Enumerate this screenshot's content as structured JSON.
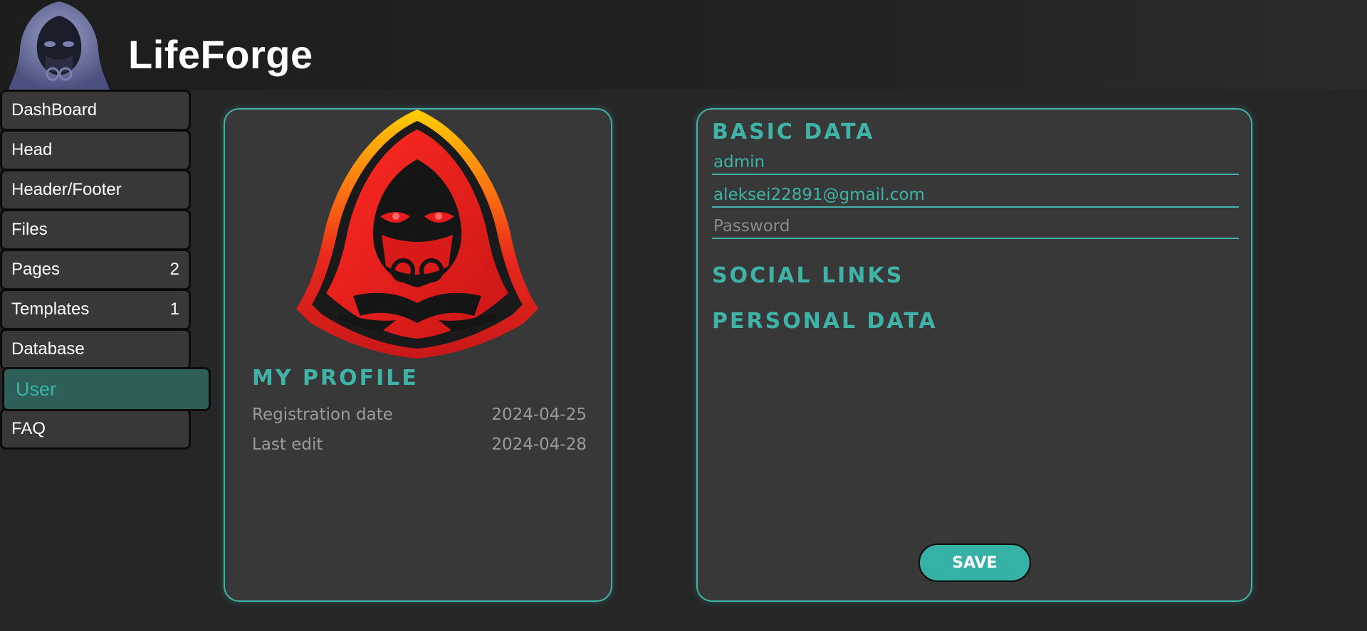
{
  "app": {
    "title": "LifeForge"
  },
  "sidebar": {
    "items": [
      {
        "label": "DashBoard",
        "count": ""
      },
      {
        "label": "Head",
        "count": ""
      },
      {
        "label": "Header/Footer",
        "count": ""
      },
      {
        "label": "Files",
        "count": ""
      },
      {
        "label": "Pages",
        "count": "2"
      },
      {
        "label": "Templates",
        "count": "1"
      },
      {
        "label": "Database",
        "count": ""
      },
      {
        "label": "User",
        "count": ""
      },
      {
        "label": "FAQ",
        "count": ""
      }
    ],
    "active": "User"
  },
  "profile": {
    "title": "MY PROFILE",
    "registration_label": "Registration date",
    "registration_value": "2024-04-25",
    "last_edit_label": "Last edit",
    "last_edit_value": "2024-04-28"
  },
  "form": {
    "basic_title": "BASIC DATA",
    "username_value": "admin",
    "email_value": "aleksei22891@gmail.com",
    "password_placeholder": "Password",
    "social_title": "SOCIAL LINKS",
    "personal_title": "PERSONAL DATA",
    "save_label": "SAVE"
  },
  "colors": {
    "accent": "#3fb3a8",
    "background": "#262626",
    "card": "#383838",
    "active_nav": "#2e5e58"
  },
  "icons": {
    "logo": "hooded-figure-icon",
    "avatar": "hooded-figure-red-icon"
  }
}
